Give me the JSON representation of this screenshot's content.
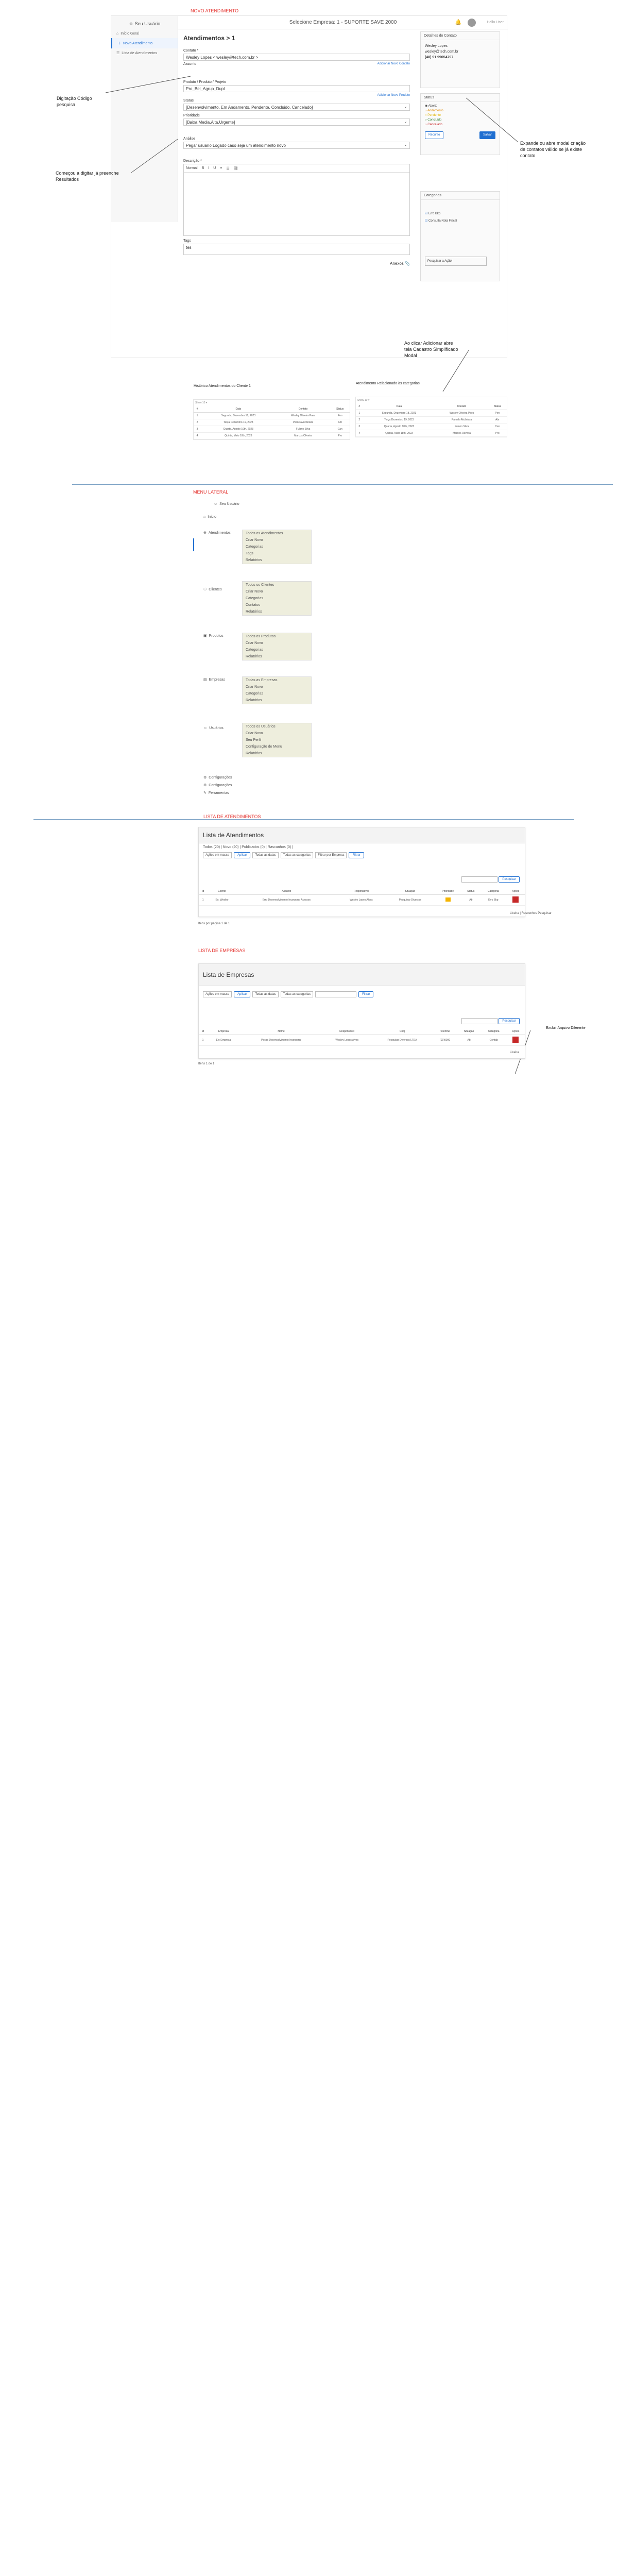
{
  "sections": {
    "novo": "NOVO ATENDIMENTO",
    "menu": "MENU LATERAL",
    "lista_atend": "LISTA DE ATENDIMENTOS",
    "lista_emp": "LISTA DE EMPRESAS"
  },
  "app": {
    "user_name": "Seu Usuário",
    "sidebar": [
      "Início Geral",
      "Novo Atendimento",
      "Lista de Atendimentos"
    ],
    "top_title": "Selecione Empresa: 1 - SUPORTE SAVE 2000",
    "top_user": "Hello User",
    "page_title": "Atendimentos > 1",
    "contato_label": "Contato *",
    "contato_value": "Wesley Lopes < wesley@tech.com.br >",
    "assunto_label": "Assunto",
    "add_contato": "Adicionar Novo Contato",
    "produto_label": "Produto / Produto / Projeto",
    "produto_value": "Pro_Bel_Agrup_Dupl",
    "add_produto": "Adicionar Novo Produto",
    "status_label": "Status",
    "status_value": "[Desenvolvimento, Em Andamento, Pendente, Concluido, Cancelado]",
    "prioridade_label": "Prioridade",
    "prioridade_value": "[Baixa,Media,Alta,Urgente]",
    "analise_label": "Análise",
    "analise_value": "Pegar usuario Logado caso seja um atendimento novo",
    "descricao_label": "Descrição *",
    "toolbar": [
      "Normal",
      "B",
      "I",
      "U",
      "≡",
      "☰",
      "⛓"
    ],
    "tags_label": "Tags",
    "tags_value": "tes",
    "anexos": "Anexos",
    "hist_title": "Histórico Atendimentos do Cliente 1",
    "hist_right_title": "Atendimento Relacionado às categorias",
    "show_label": "Show 10 ▾",
    "tbl_headers": [
      "#",
      "Data",
      "Contato",
      "Status"
    ],
    "tbl_rows": [
      [
        "1",
        "Segunda, Dezembro 18, 2023",
        "Wesley Oliveira Paes",
        "Pen"
      ],
      [
        "2",
        "Terça Dezembro 19, 2023",
        "Pamela Alcântara",
        "Abr"
      ],
      [
        "3",
        "Quarta, Agosto 10th, 2023",
        "Fulano Silva",
        "Can"
      ],
      [
        "4",
        "Quinta, Maio 18th, 2023",
        "Marcos Oliveira",
        "Pro"
      ]
    ],
    "contact_panel": "Detalhes do Contato",
    "contact_name": "Wesley Lopes",
    "contact_email": "wesley@tech.com.br",
    "contact_phone": "(48) 91 99054797",
    "status_panel": "Status",
    "status_items": [
      "Aberto",
      "Andamento",
      "Pendente",
      "Concluído",
      "Cancelado"
    ],
    "save_btn": "Salvar",
    "back_btn": "Recurso",
    "cat_panel": "Categorias",
    "cat_items": [
      "Erro Bkp",
      "Consulta Nota Fiscal"
    ],
    "cat_search": "Pesquisar a Ação!"
  },
  "notes": {
    "n1": "Digitação Código pesquisa",
    "n2": "Começou a digitar já preenche Resultados",
    "n3": "Expande ou abre modal criação de contatos válido se já existe contato",
    "n4": "Ao clicar Adicionar abre tela Cadastro Simplificado Modal"
  },
  "menu": {
    "user": "Seu Usuário",
    "inicio": "Início",
    "groups": [
      {
        "title": "Atendimentos",
        "items": [
          "Todos os Atendimentos",
          "Criar Novo",
          "Categorias",
          "Tags",
          "Relatórios"
        ]
      },
      {
        "title": "Clientes",
        "items": [
          "Todos os Clientes",
          "Criar Novo",
          "Categorias",
          "Contatos",
          "Relatórios"
        ]
      },
      {
        "title": "Produtos",
        "items": [
          "Todos os Produtos",
          "Criar Novo",
          "Categorias",
          "Relatórios"
        ]
      },
      {
        "title": "Empresas",
        "items": [
          "Todas as Empresas",
          "Criar Novo",
          "Categorias",
          "Relatórios"
        ]
      },
      {
        "title": "Usuários",
        "items": [
          "Todos os Usuários",
          "Criar Novo",
          "Seu Perfil",
          "Configuração de Menu",
          "Relatórios"
        ]
      }
    ],
    "extra": [
      "Configurações",
      "Configurações",
      "Ferramentas"
    ]
  },
  "lista_atend": {
    "title": "Lista de Atendimentos",
    "tabs": "Todos (20) | Novo (20) | Publicados (0) | Rascunhos (0) |",
    "filters": [
      "Ações em massa",
      "Todas as datas",
      "Todas as categorias",
      "Filtrar por Empresa"
    ],
    "apply": "Aplicar",
    "filter": "Filtrar",
    "search_btn": "Pesquisar",
    "headers": [
      "Id",
      "Cliente",
      "Assunto",
      "Responsável",
      "Situação",
      "Prioridade",
      "Status",
      "Categoria",
      "Ações"
    ],
    "row": [
      "1",
      "Ex: Wesley",
      "Erro Desenvolvimento Incorporar Acessos",
      "Wesley Lopes Alves",
      "Pesquisar Diversos",
      "",
      "Ab",
      "Erro Bkp",
      ""
    ],
    "pager": "Itens por página 1 de 1",
    "trash": "Lixeira | Rascunhos Pesquisar"
  },
  "lista_emp": {
    "title": "Lista de Empresas",
    "filters": [
      "Ações em massa",
      "Todas as datas",
      "Todas as categorias",
      ""
    ],
    "apply": "Aplicar",
    "filter": "Filtrar",
    "search_btn": "Pesquisar",
    "headers": [
      "Id",
      "Empresa",
      "Nome",
      "Responsável",
      "Cnpj",
      "Telefone",
      "Situação",
      "Categoria",
      "Ações"
    ],
    "row": [
      "1",
      "Ex: Empresa",
      "Pecas Desenvolvimento Incorporar",
      "Wesley Lopes Alves",
      "Pesquisar Diversos LTDA",
      "(00)0000",
      "Ab",
      "Contab",
      ""
    ],
    "pager": "Itens 1 de 1",
    "trash": "Lixeira",
    "note": "Excluir Arquivo Diferente"
  },
  "colors": {
    "accent": "#1f6fd1",
    "red": "#e53935",
    "line": "#7aa0c4",
    "status_red": "#c62828"
  }
}
